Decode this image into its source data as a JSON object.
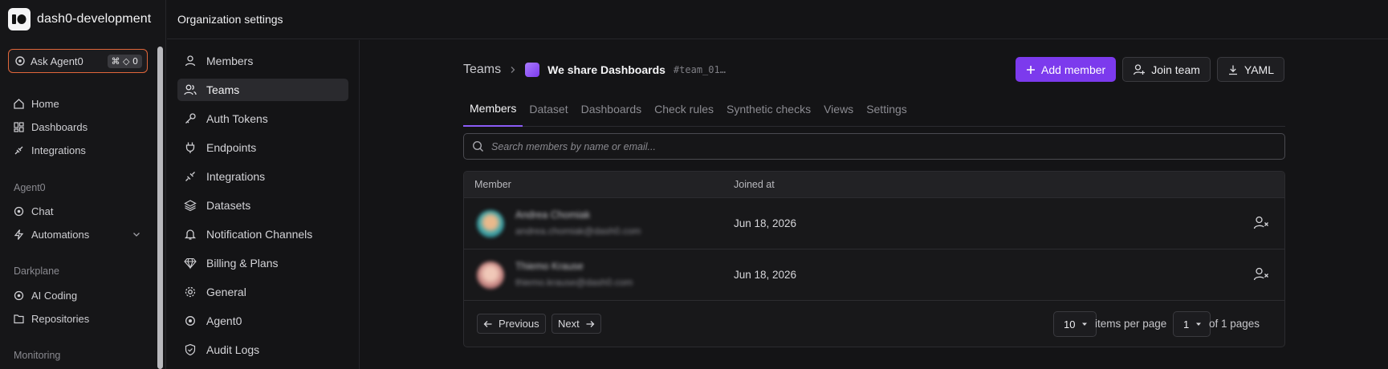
{
  "org": {
    "name": "dash0-development"
  },
  "ask": {
    "label": "Ask Agent0",
    "shortcut": "⌘ ◇ 0"
  },
  "sidebar": {
    "items": [
      {
        "label": "Home"
      },
      {
        "label": "Dashboards"
      },
      {
        "label": "Integrations"
      }
    ],
    "sections": [
      {
        "title": "Agent0",
        "items": [
          {
            "label": "Chat"
          },
          {
            "label": "Automations"
          }
        ]
      },
      {
        "title": "Darkplane",
        "items": [
          {
            "label": "AI Coding"
          },
          {
            "label": "Repositories"
          }
        ]
      },
      {
        "title": "Monitoring"
      }
    ]
  },
  "header": {
    "title": "Organization settings"
  },
  "settings_nav": {
    "items": [
      {
        "label": "Members"
      },
      {
        "label": "Teams"
      },
      {
        "label": "Auth Tokens"
      },
      {
        "label": "Endpoints"
      },
      {
        "label": "Integrations"
      },
      {
        "label": "Datasets"
      },
      {
        "label": "Notification Channels"
      },
      {
        "label": "Billing & Plans"
      },
      {
        "label": "General"
      },
      {
        "label": "Agent0"
      },
      {
        "label": "Audit Logs"
      }
    ],
    "active": "Teams"
  },
  "breadcrumb": {
    "root": "Teams",
    "team": "We share Dashboards",
    "team_id": "#team_01…"
  },
  "actions": {
    "add_member": "Add member",
    "join_team": "Join team",
    "yaml": "YAML"
  },
  "tabs": [
    {
      "label": "Members",
      "active": true
    },
    {
      "label": "Dataset"
    },
    {
      "label": "Dashboards"
    },
    {
      "label": "Check rules"
    },
    {
      "label": "Synthetic checks"
    },
    {
      "label": "Views"
    },
    {
      "label": "Settings"
    }
  ],
  "search": {
    "placeholder": "Search members by name or email...",
    "value": ""
  },
  "table": {
    "columns": {
      "member": "Member",
      "joined": "Joined at"
    },
    "rows": [
      {
        "name": "Andrea Chomiak",
        "email": "andrea.chomiak@dash0.com",
        "joined": "Jun 18, 2026"
      },
      {
        "name": "Thiemo Krause",
        "email": "thiemo.krause@dash0.com",
        "joined": "Jun 18, 2026"
      }
    ]
  },
  "pagination": {
    "previous": "Previous",
    "next": "Next",
    "per_page": "10",
    "per_page_label": "items per page",
    "page": "1",
    "pages_label": "of 1 pages"
  },
  "colors": {
    "accent": "#7c3aed",
    "ask_border": "#e0663a",
    "background": "#141416"
  }
}
